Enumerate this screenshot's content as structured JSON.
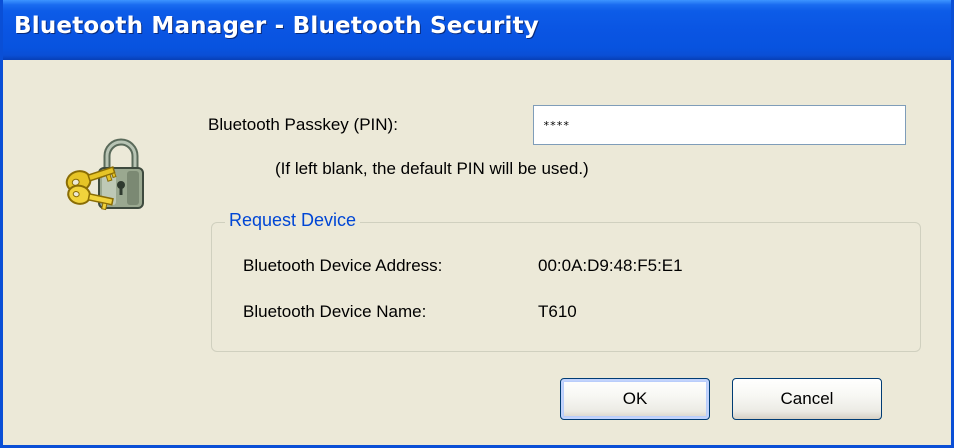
{
  "window": {
    "title": "Bluetooth Manager - Bluetooth Security"
  },
  "icon": "lock-keys-icon",
  "pin": {
    "label": "Bluetooth Passkey (PIN):",
    "value": "****",
    "hint": "(If left blank, the default PIN will be used.)"
  },
  "request_device": {
    "legend": "Request Device",
    "address_label": "Bluetooth Device Address:",
    "address_value": "00:0A:D9:48:F5:E1",
    "name_label": "Bluetooth Device Name:",
    "name_value": "T610"
  },
  "buttons": {
    "ok": "OK",
    "cancel": "Cancel"
  },
  "colors": {
    "titlebar": "#0a55e3",
    "client": "#ece9d8",
    "group_legend": "#0046d5",
    "input_border": "#7f9db9"
  }
}
